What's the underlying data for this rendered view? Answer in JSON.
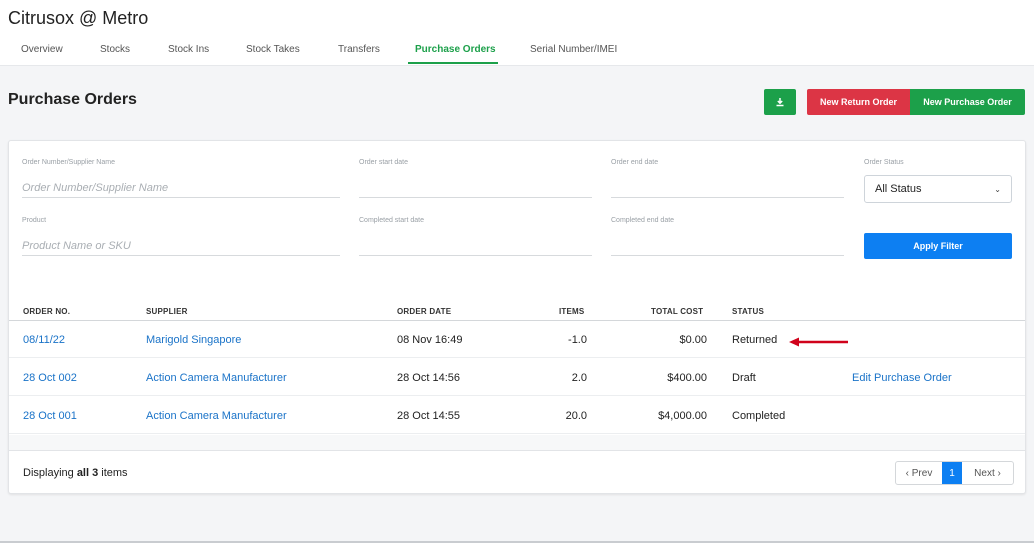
{
  "header": {
    "store_title": "Citrusox @ Metro",
    "tabs": [
      {
        "label": "Overview"
      },
      {
        "label": "Stocks"
      },
      {
        "label": "Stock Ins"
      },
      {
        "label": "Stock Takes"
      },
      {
        "label": "Transfers"
      },
      {
        "label": "Purchase Orders",
        "active": true
      },
      {
        "label": "Serial Number/IMEI"
      }
    ]
  },
  "page": {
    "title": "Purchase Orders",
    "download_icon": "download-icon",
    "new_return_label": "New Return Order",
    "new_purchase_label": "New Purchase Order"
  },
  "filters": {
    "order_number": {
      "label": "Order Number/Supplier Name",
      "placeholder": "Order Number/Supplier Name",
      "value": ""
    },
    "order_start": {
      "label": "Order start date",
      "value": ""
    },
    "order_end": {
      "label": "Order end date",
      "value": ""
    },
    "order_status": {
      "label": "Order Status",
      "selected": "All Status"
    },
    "product": {
      "label": "Product",
      "placeholder": "Product Name or SKU",
      "value": ""
    },
    "completed_start": {
      "label": "Completed start date",
      "value": ""
    },
    "completed_end": {
      "label": "Completed end date",
      "value": ""
    },
    "apply_label": "Apply Filter"
  },
  "table": {
    "columns": [
      "ORDER NO.",
      "SUPPLIER",
      "ORDER DATE",
      "ITEMS",
      "TOTAL COST",
      "STATUS"
    ],
    "rows": [
      {
        "order_no": "08/11/22",
        "supplier": "Marigold Singapore",
        "order_date": "08 Nov 16:49",
        "items": "-1.0",
        "total_cost": "$0.00",
        "status": "Returned",
        "action": ""
      },
      {
        "order_no": "28 Oct 002",
        "supplier": "Action Camera Manufacturer",
        "order_date": "28 Oct 14:56",
        "items": "2.0",
        "total_cost": "$400.00",
        "status": "Draft",
        "action": "Edit Purchase Order"
      },
      {
        "order_no": "28 Oct 001",
        "supplier": "Action Camera Manufacturer",
        "order_date": "28 Oct 14:55",
        "items": "20.0",
        "total_cost": "$4,000.00",
        "status": "Completed",
        "action": ""
      }
    ]
  },
  "footer": {
    "display_prefix": "Displaying",
    "display_bold": "all 3",
    "display_suffix": "items",
    "prev_label": "‹ Prev",
    "current_page": "1",
    "next_label": "Next ›"
  },
  "colors": {
    "accent_green": "#1ca04a",
    "danger_red": "#dc3545",
    "primary_blue": "#0d7ff2",
    "link_blue": "#1a73c8",
    "annotation_arrow": "#d0021b"
  }
}
